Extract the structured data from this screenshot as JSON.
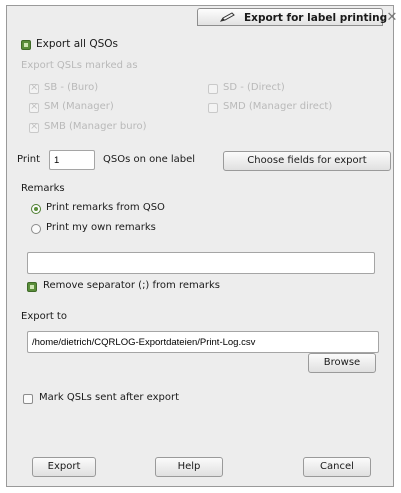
{
  "window": {
    "title": "Export for label printing",
    "close_glyph": "✕"
  },
  "export_all": {
    "label": "Export all QSOs",
    "checked": true
  },
  "marked_as": {
    "heading": "Export QSLs marked as",
    "options": [
      {
        "label": "SB - (Buro)",
        "checked": true
      },
      {
        "label": "SD - (Direct)",
        "checked": false
      },
      {
        "label": "SM (Manager)",
        "checked": true
      },
      {
        "label": "SMD (Manager direct)",
        "checked": false
      },
      {
        "label": "SMB (Manager buro)",
        "checked": true
      }
    ]
  },
  "print_row": {
    "label_before": "Print",
    "count_value": "1",
    "label_after": "QSOs on one label",
    "choose_fields_button": "Choose fields for export"
  },
  "remarks": {
    "heading": "Remarks",
    "option_qso": "Print remarks from QSO",
    "option_own": "Print my own remarks",
    "selected": "option_qso",
    "own_remarks_value": "",
    "remove_separator_label": "Remove separator (;) from remarks",
    "remove_separator_checked": true
  },
  "export_to": {
    "heading": "Export to",
    "path_value": "/home/dietrich/CQRLOG-Exportdateien/Print-Log.csv",
    "browse_button": "Browse"
  },
  "mark_sent": {
    "label": "Mark QSLs sent after export",
    "checked": false
  },
  "buttons": {
    "export": "Export",
    "help": "Help",
    "cancel": "Cancel"
  },
  "colors": {
    "accent_green": "#5a8e3a",
    "window_bg": "#ededed"
  },
  "icons": {
    "title_icon": "pencil-icon",
    "close_icon": "close-icon"
  }
}
